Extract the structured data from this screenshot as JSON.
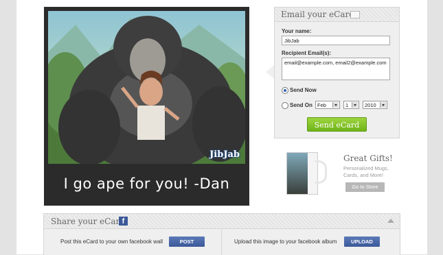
{
  "ecard": {
    "caption": "I go ape for you! -Dan",
    "logo": "JibJab"
  },
  "email_panel": {
    "title": "Email your eCard",
    "your_name_label": "Your name:",
    "your_name_value": "JibJab",
    "recipient_label": "Recipient Email(s):",
    "recipient_value": "email@example.com, email2@example.com",
    "send_now_label": "Send Now",
    "send_on_label": "Send On",
    "month": "Feb",
    "day": "1",
    "year": "2010",
    "send_button": "Send eCard"
  },
  "gifts": {
    "title": "Great Gifts!",
    "subtitle": "Personalized Mugs, Cards, and More!",
    "store_button": "Go to Store"
  },
  "share": {
    "title": "Share your eCard",
    "fb_icon": "f",
    "wall_text": "Post this eCard to your own facebook wall",
    "post_button": "POST",
    "album_text": "Upload this image to your facebook album",
    "upload_button": "UPLOAD"
  },
  "colors": {
    "send_button": "#7ac225",
    "facebook": "#3b5998"
  }
}
